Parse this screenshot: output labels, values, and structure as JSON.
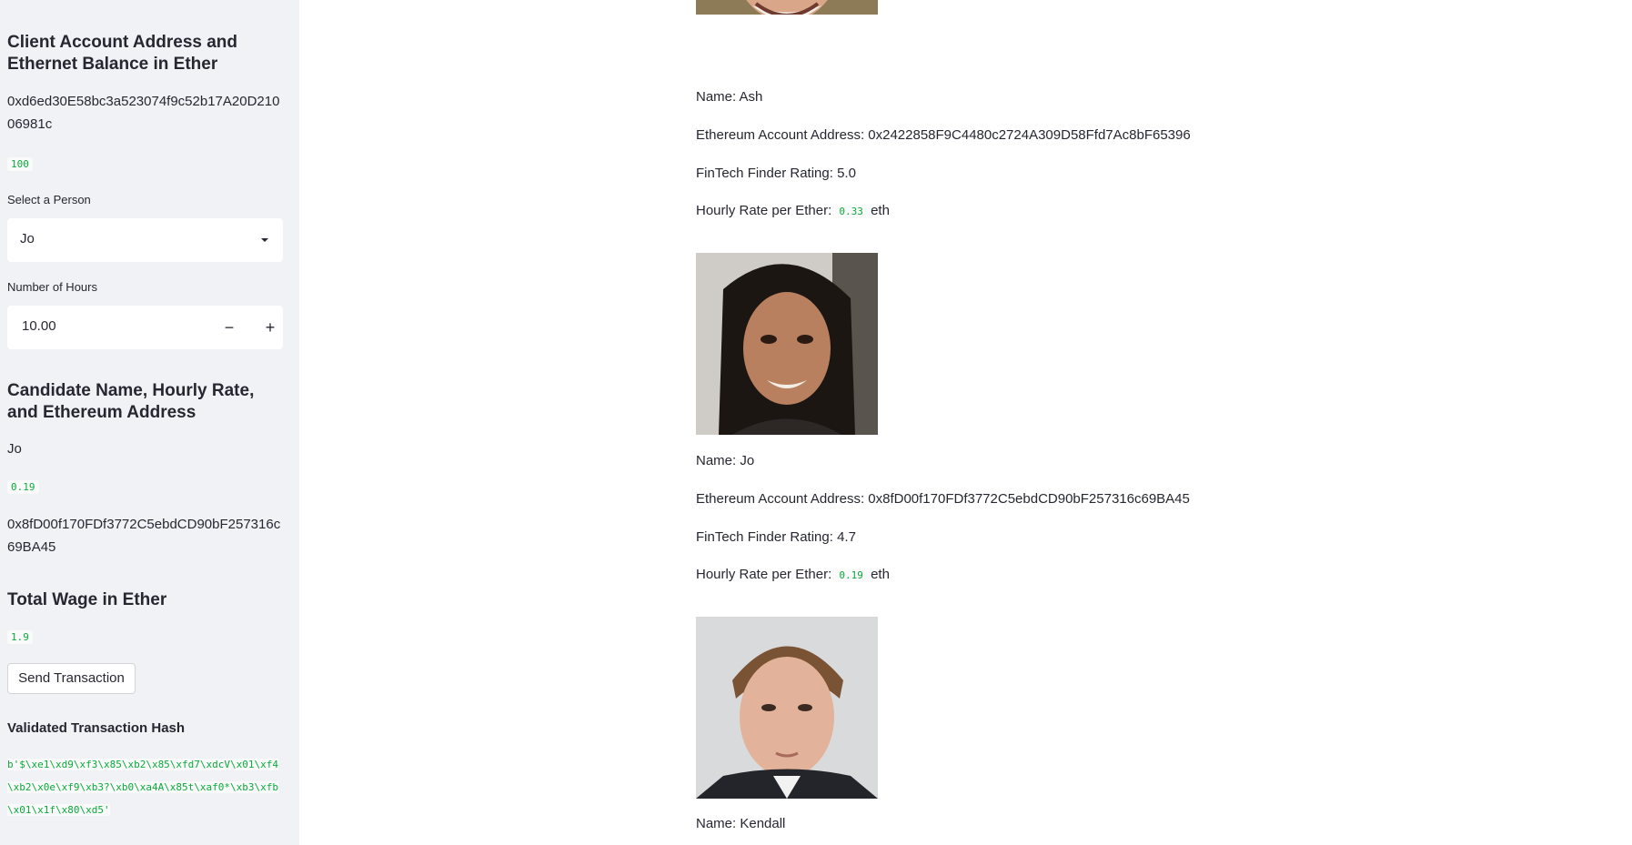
{
  "sidebar": {
    "client_heading": "Client Account Address and Ethernet Balance in Ether",
    "client_address": "0xd6ed30E58bc3a523074f9c52b17A20D21006981c",
    "client_balance": "100",
    "select_person_label": "Select a Person",
    "selected_person": "Jo",
    "hours_label": "Number of Hours",
    "hours_value": "10.00",
    "decrement_symbol": "−",
    "increment_symbol": "+",
    "candidate_heading": "Candidate Name, Hourly Rate, and Ethereum Address",
    "candidate_name": "Jo",
    "candidate_rate": "0.19",
    "candidate_address": "0x8fD00f170FDf3772C5ebdCD90bF257316c69BA45",
    "total_wage_heading": "Total Wage in Ether",
    "total_wage": "1.9",
    "send_button": "Send Transaction",
    "tx_hash_heading": "Validated Transaction Hash",
    "tx_hash": "b'$\\xe1\\xd9\\xf3\\x85\\xb2\\x85\\xfd7\\xdcV\\x01\\xf4\\xb2\\x0e\\xf9\\xb3?\\xb0\\xa4A\\x85t\\xaf0*\\xb3\\xfb\\x01\\x1f\\x80\\xd5'"
  },
  "candidates": [
    {
      "name_line": "Name: Ash",
      "address_line": "Ethereum Account Address: 0x2422858F9C4480c2724A309D58Ffd7Ac8bF65396",
      "rating_line": "FinTech Finder Rating: 5.0",
      "rate_prefix": "Hourly Rate per Ether:",
      "rate_value": "0.33",
      "rate_suffix": "eth",
      "photo_icon": "person-photo-icon"
    },
    {
      "name_line": "Name: Jo",
      "address_line": "Ethereum Account Address: 0x8fD00f170FDf3772C5ebdCD90bF257316c69BA45",
      "rating_line": "FinTech Finder Rating: 4.7",
      "rate_prefix": "Hourly Rate per Ether:",
      "rate_value": "0.19",
      "rate_suffix": "eth",
      "photo_icon": "person-photo-icon"
    },
    {
      "name_line": "Name: Kendall",
      "photo_icon": "person-photo-icon"
    }
  ],
  "colors": {
    "sidebar_bg": "#f0f2f6",
    "code_green": "#09ab3b",
    "text": "#262730"
  }
}
